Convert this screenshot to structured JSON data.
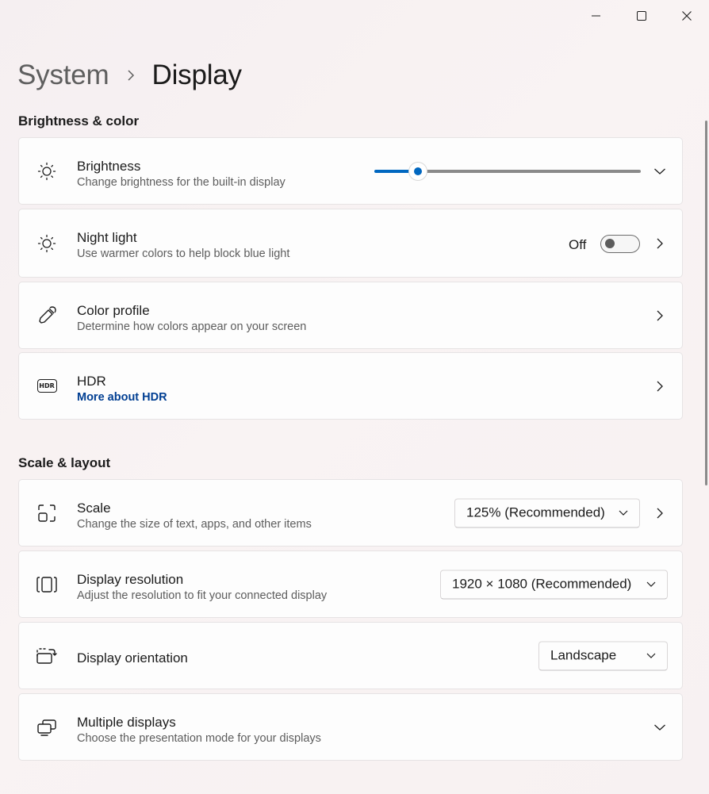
{
  "window": {
    "minimize_icon": "minimize-icon",
    "maximize_icon": "maximize-icon",
    "close_icon": "close-icon"
  },
  "breadcrumb": {
    "parent": "System",
    "current": "Display"
  },
  "sections": {
    "brightness_color": "Brightness & color",
    "scale_layout": "Scale & layout"
  },
  "brightness": {
    "title": "Brightness",
    "subtitle": "Change brightness for the built-in display",
    "level_percent": 16,
    "accent": "#0067c0"
  },
  "night_light": {
    "title": "Night light",
    "subtitle": "Use warmer colors to help block blue light",
    "state_label": "Off",
    "enabled": false
  },
  "color_profile": {
    "title": "Color profile",
    "subtitle": "Determine how colors appear on your screen"
  },
  "hdr": {
    "title": "HDR",
    "link": "More about HDR",
    "icon_text": "HDR"
  },
  "scale": {
    "title": "Scale",
    "subtitle": "Change the size of text, apps, and other items",
    "value": "125% (Recommended)"
  },
  "resolution": {
    "title": "Display resolution",
    "subtitle": "Adjust the resolution to fit your connected display",
    "value": "1920 × 1080 (Recommended)"
  },
  "orientation": {
    "title": "Display orientation",
    "value": "Landscape"
  },
  "multiple_displays": {
    "title": "Multiple displays",
    "subtitle": "Choose the presentation mode for your displays"
  }
}
